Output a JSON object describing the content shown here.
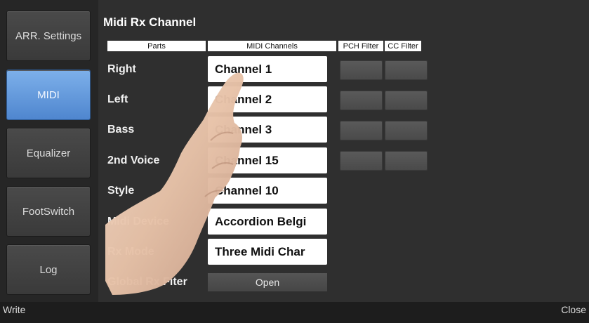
{
  "sidebar": {
    "items": [
      {
        "label": "ARR. Settings",
        "active": false
      },
      {
        "label": "MIDI",
        "active": true
      },
      {
        "label": "Equalizer",
        "active": false
      },
      {
        "label": "FootSwitch",
        "active": false
      },
      {
        "label": "Log",
        "active": false
      }
    ]
  },
  "main": {
    "title": "Midi Rx Channel",
    "headers": {
      "parts": "Parts",
      "channels": "MIDI Channels",
      "pch": "PCH Filter",
      "cc": "CC Filter"
    },
    "rows": [
      {
        "label": "Right",
        "value": "Channel 1"
      },
      {
        "label": "Left",
        "value": "Channel 2"
      },
      {
        "label": "Bass",
        "value": "Channel 3"
      },
      {
        "label": "2nd Voice",
        "value": "Channel 15"
      },
      {
        "label": "Style",
        "value": "Channel 10"
      },
      {
        "label": "Midi Device",
        "value": "Accordion Belgi"
      },
      {
        "label": "Rx Mode",
        "value": "Three Midi Char"
      }
    ],
    "global_rx": {
      "label": "Global Rx Fiter",
      "button": "Open"
    }
  },
  "footer": {
    "write": "Write",
    "close": "Close"
  },
  "colors": {
    "accent": "#5b93d8",
    "background": "#2f2f2f"
  }
}
